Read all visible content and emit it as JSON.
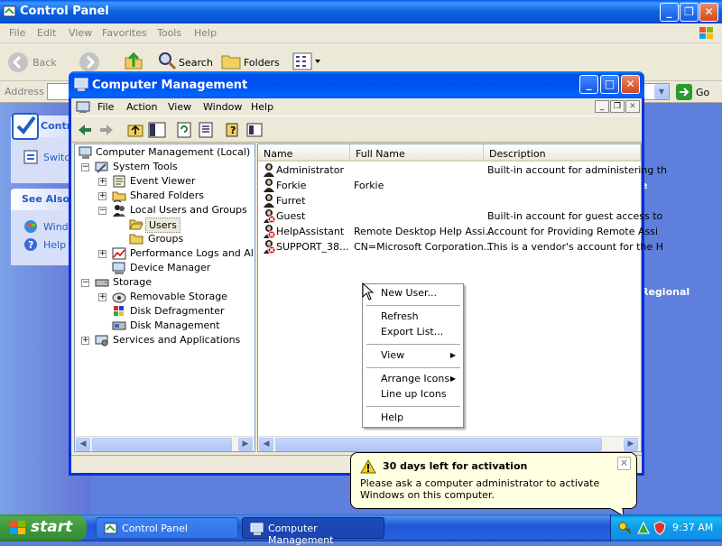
{
  "control_panel": {
    "title": "Control Panel",
    "menu": [
      "File",
      "Edit",
      "View",
      "Favorites",
      "Tools",
      "Help"
    ],
    "toolbar": {
      "back": "Back",
      "search": "Search",
      "folders": "Folders"
    },
    "address_label": "Address",
    "go_label": "Go",
    "left_panel": {
      "control_header": "Contro",
      "switch_link": "Switch",
      "see_also_header": "See Also",
      "windows_link": "Windo",
      "help_link": "Help a"
    },
    "bg_text_1": "e",
    "bg_text_2": "Regional"
  },
  "computer_management": {
    "title": "Computer Management",
    "menu": [
      "File",
      "Action",
      "View",
      "Window",
      "Help"
    ],
    "tree": [
      {
        "label": "Computer Management (Local)",
        "level": 0,
        "icon": "computer-icon"
      },
      {
        "label": "System Tools",
        "level": 1,
        "expander": "-",
        "icon": "tools-icon"
      },
      {
        "label": "Event Viewer",
        "level": 2,
        "expander": "+",
        "icon": "event-viewer-icon"
      },
      {
        "label": "Shared Folders",
        "level": 2,
        "expander": "+",
        "icon": "shared-folder-icon"
      },
      {
        "label": "Local Users and Groups",
        "level": 2,
        "expander": "-",
        "icon": "users-groups-icon"
      },
      {
        "label": "Users",
        "level": 3,
        "icon": "folder-open-icon",
        "selected": true
      },
      {
        "label": "Groups",
        "level": 3,
        "icon": "folder-icon"
      },
      {
        "label": "Performance Logs and Alerts",
        "level": 2,
        "expander": "+",
        "icon": "performance-icon"
      },
      {
        "label": "Device Manager",
        "level": 2,
        "icon": "device-manager-icon"
      },
      {
        "label": "Storage",
        "level": 1,
        "expander": "-",
        "icon": "storage-icon"
      },
      {
        "label": "Removable Storage",
        "level": 2,
        "expander": "+",
        "icon": "removable-storage-icon"
      },
      {
        "label": "Disk Defragmenter",
        "level": 2,
        "icon": "defrag-icon"
      },
      {
        "label": "Disk Management",
        "level": 2,
        "icon": "disk-management-icon"
      },
      {
        "label": "Services and Applications",
        "level": 1,
        "expander": "+",
        "icon": "services-icon"
      }
    ],
    "columns": [
      "Name",
      "Full Name",
      "Description"
    ],
    "users": [
      {
        "name": "Administrator",
        "full_name": "",
        "description": "Built-in account for administering th",
        "disabled": false
      },
      {
        "name": "Forkie",
        "full_name": "Forkie",
        "description": "",
        "disabled": false
      },
      {
        "name": "Furret",
        "full_name": "",
        "description": "",
        "disabled": false
      },
      {
        "name": "Guest",
        "full_name": "",
        "description": "Built-in account for guest access to",
        "disabled": true
      },
      {
        "name": "HelpAssistant",
        "full_name": "Remote Desktop Help Assi...",
        "description": "Account for Providing Remote Assi",
        "disabled": true
      },
      {
        "name": "SUPPORT_38...",
        "full_name": "CN=Microsoft Corporation...",
        "description": "This is a vendor's account for the H",
        "disabled": true
      }
    ]
  },
  "context_menu": {
    "items": [
      {
        "label": "New User...",
        "submenu": false
      },
      {
        "label": "Refresh",
        "submenu": false
      },
      {
        "label": "Export List...",
        "submenu": false
      },
      {
        "label": "View",
        "submenu": true
      },
      {
        "label": "Arrange Icons",
        "submenu": true
      },
      {
        "label": "Line up Icons",
        "submenu": false
      },
      {
        "label": "Help",
        "submenu": false
      }
    ]
  },
  "balloon": {
    "title": "30 days left for activation",
    "message": "Please ask a computer administrator to activate Windows on this computer.",
    "close": "×"
  },
  "taskbar": {
    "start_label": "start",
    "tasks": [
      "Control Panel",
      "Computer Management"
    ],
    "clock": "9:37 AM"
  }
}
